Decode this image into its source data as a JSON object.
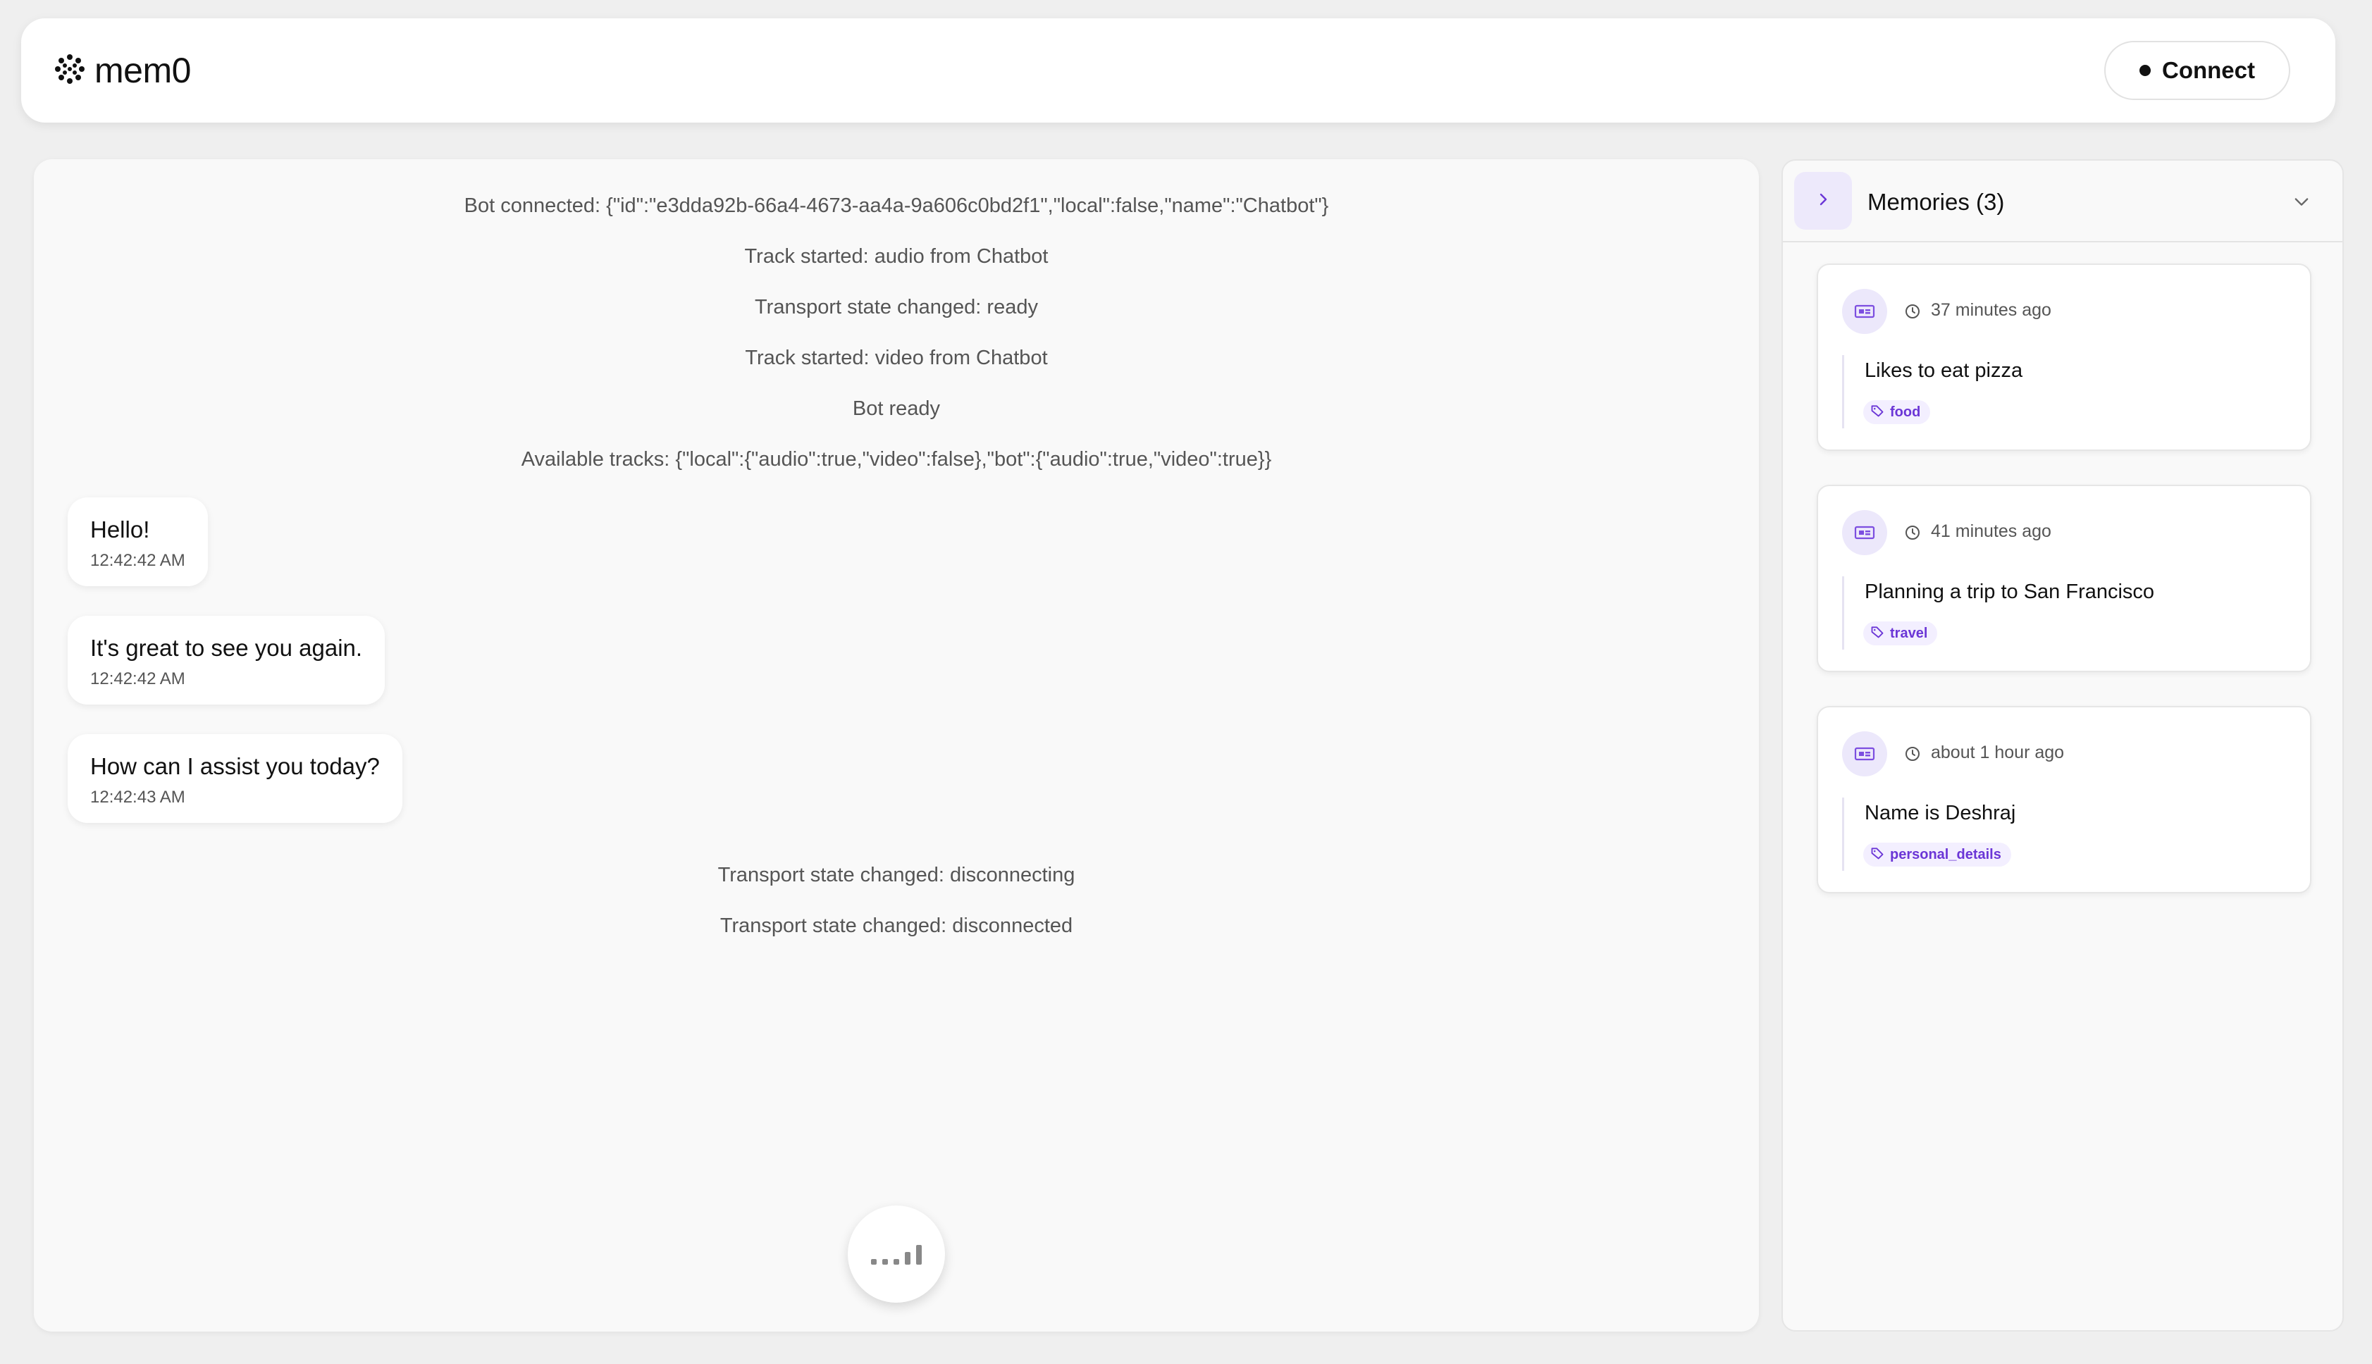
{
  "header": {
    "logo_text": "mem0",
    "connect_label": "Connect"
  },
  "chat": {
    "system_messages_top": [
      "Bot connected: {\"id\":\"e3dda92b-66a4-4673-aa4a-9a606c0bd2f1\",\"local\":false,\"name\":\"Chatbot\"}",
      "Track started: audio from Chatbot",
      "Transport state changed: ready",
      "Track started: video from Chatbot",
      "Bot ready",
      "Available tracks: {\"local\":{\"audio\":true,\"video\":false},\"bot\":{\"audio\":true,\"video\":true}}"
    ],
    "messages": [
      {
        "text": "Hello!",
        "time": "12:42:42 AM"
      },
      {
        "text": "It's great to see you again.",
        "time": "12:42:42 AM"
      },
      {
        "text": "How can I assist you today?",
        "time": "12:42:43 AM"
      }
    ],
    "system_messages_bottom": [
      "Transport state changed: disconnecting",
      "Transport state changed: disconnected"
    ]
  },
  "memories": {
    "title": "Memories (3)",
    "items": [
      {
        "time": "37 minutes ago",
        "text": "Likes to eat pizza",
        "tag": "food"
      },
      {
        "time": "41 minutes ago",
        "text": "Planning a trip to San Francisco",
        "tag": "travel"
      },
      {
        "time": "about 1 hour ago",
        "text": "Name is Deshraj",
        "tag": "personal_details"
      }
    ]
  },
  "colors": {
    "accent": "#6b36d6",
    "accent_light": "#ede9fb",
    "background": "#efefef"
  },
  "icons": {
    "logo": "mem0-logo-icon",
    "connect": "status-dot-icon",
    "mic": "audio-level-icon",
    "toggle": "chevron-right-icon",
    "collapse": "chevron-down-icon",
    "memory": "memory-card-icon",
    "time": "clock-icon",
    "tag": "tag-icon"
  }
}
